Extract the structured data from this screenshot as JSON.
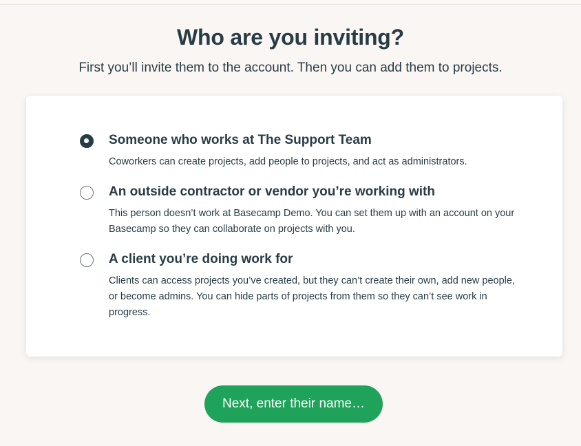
{
  "header": {
    "title": "Who are you inviting?",
    "subtitle": "First you’ll invite them to the account. Then you can add them to projects."
  },
  "options": [
    {
      "title": "Someone who works at The Support Team",
      "description": "Coworkers can create projects, add people to projects, and act as administrators.",
      "selected": true
    },
    {
      "title": "An outside contractor or vendor you’re working with",
      "description": "This person doesn’t work at Basecamp Demo. You can set them up with an account on your Basecamp so they can collaborate on projects with you.",
      "selected": false
    },
    {
      "title": "A client you’re doing work for",
      "description": "Clients can access projects you’ve created, but they can’t create their own, add new people, or become admins. You can hide parts of projects from them so they can’t see work in progress.",
      "selected": false
    }
  ],
  "next_button": {
    "label": "Next, enter their name…"
  },
  "colors": {
    "background": "#faf6f3",
    "text": "#283c46",
    "accent": "#1fa25a",
    "card": "#ffffff"
  }
}
